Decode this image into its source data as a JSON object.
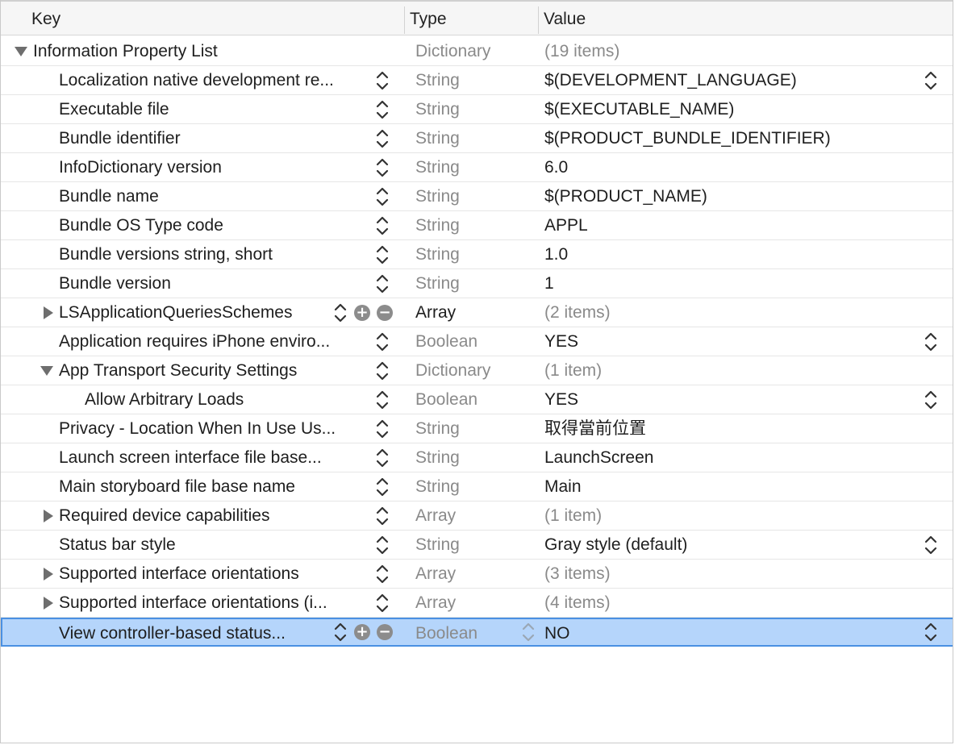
{
  "header": {
    "key": "Key",
    "type": "Type",
    "value": "Value"
  },
  "root": {
    "key": "Information Property List",
    "type": "Dictionary",
    "value": "(19 items)"
  },
  "rows": [
    {
      "key": "Localization native development re...",
      "type": "String",
      "value": "$(DEVELOPMENT_LANGUAGE)"
    },
    {
      "key": "Executable file",
      "type": "String",
      "value": "$(EXECUTABLE_NAME)"
    },
    {
      "key": "Bundle identifier",
      "type": "String",
      "value": "$(PRODUCT_BUNDLE_IDENTIFIER)"
    },
    {
      "key": "InfoDictionary version",
      "type": "String",
      "value": "6.0"
    },
    {
      "key": "Bundle name",
      "type": "String",
      "value": "$(PRODUCT_NAME)"
    },
    {
      "key": "Bundle OS Type code",
      "type": "String",
      "value": "APPL"
    },
    {
      "key": "Bundle versions string, short",
      "type": "String",
      "value": "1.0"
    },
    {
      "key": "Bundle version",
      "type": "String",
      "value": "1"
    },
    {
      "key": "LSApplicationQueriesSchemes",
      "type": "Array",
      "value": "(2 items)"
    },
    {
      "key": "Application requires iPhone enviro...",
      "type": "Boolean",
      "value": "YES"
    },
    {
      "key": "App Transport Security Settings",
      "type": "Dictionary",
      "value": "(1 item)"
    },
    {
      "key": "Allow Arbitrary Loads",
      "type": "Boolean",
      "value": "YES"
    },
    {
      "key": "Privacy - Location When In Use Us...",
      "type": "String",
      "value": "取得當前位置"
    },
    {
      "key": "Launch screen interface file base...",
      "type": "String",
      "value": "LaunchScreen"
    },
    {
      "key": "Main storyboard file base name",
      "type": "String",
      "value": "Main"
    },
    {
      "key": "Required device capabilities",
      "type": "Array",
      "value": "(1 item)"
    },
    {
      "key": "Status bar style",
      "type": "String",
      "value": "Gray style (default)"
    },
    {
      "key": "Supported interface orientations",
      "type": "Array",
      "value": "(3 items)"
    },
    {
      "key": "Supported interface orientations (i...",
      "type": "Array",
      "value": "(4 items)"
    },
    {
      "key": "View controller-based status...",
      "type": "Boolean",
      "value": "NO"
    }
  ],
  "icons": {
    "disclosure_expanded": "disclosure-triangle-down-icon",
    "disclosure_collapsed": "disclosure-triangle-right-icon",
    "stepper": "up-down-stepper-icon",
    "add": "plus-circle-icon",
    "remove": "minus-circle-icon"
  },
  "colors": {
    "selection_fill": "#b5d5fb",
    "selection_border": "#4a90e2",
    "secondary_text": "#8a8a8a",
    "primary_text": "#1e1e1e"
  }
}
